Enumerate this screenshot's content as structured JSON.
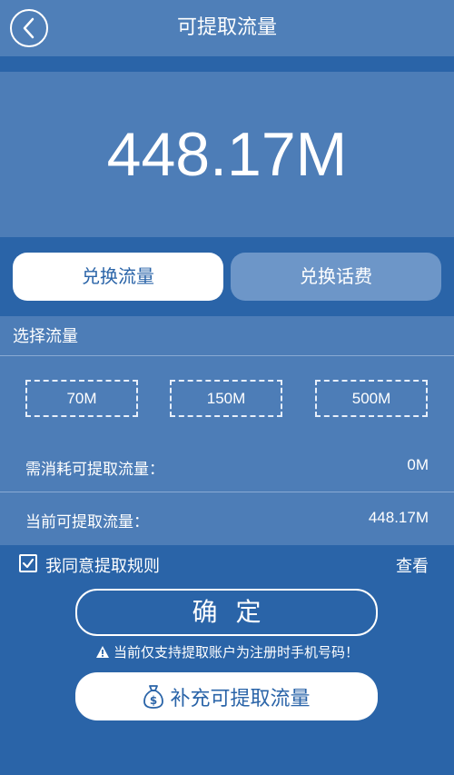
{
  "header": {
    "title": "可提取流量"
  },
  "balance": {
    "amount": "448.17M"
  },
  "tabs": [
    {
      "label": "兑换流量",
      "active": true
    },
    {
      "label": "兑换话费",
      "active": false
    }
  ],
  "select": {
    "label": "选择流量",
    "options": [
      "70M",
      "150M",
      "500M"
    ]
  },
  "info": {
    "consume_label": "需消耗可提取流量：",
    "consume_value": "0M",
    "current_label": "当前可提取流量：",
    "current_value": "448.17M"
  },
  "agree": {
    "text": "我同意提取规则",
    "checked": true,
    "view_label": "查看"
  },
  "confirm": {
    "label": "确定"
  },
  "notice": {
    "text": "当前仅支持提取账户为注册时手机号码！"
  },
  "supplement": {
    "label": "补充可提取流量"
  },
  "colors": {
    "primary_dark": "#2a64a8",
    "primary_light": "#4d7db7",
    "tab_inactive": "#6d96c8",
    "white": "#ffffff"
  },
  "icons": {
    "back": "chevron-left-icon",
    "checkbox": "checkmark-icon",
    "warning": "warning-icon",
    "money": "money-bag-icon"
  }
}
